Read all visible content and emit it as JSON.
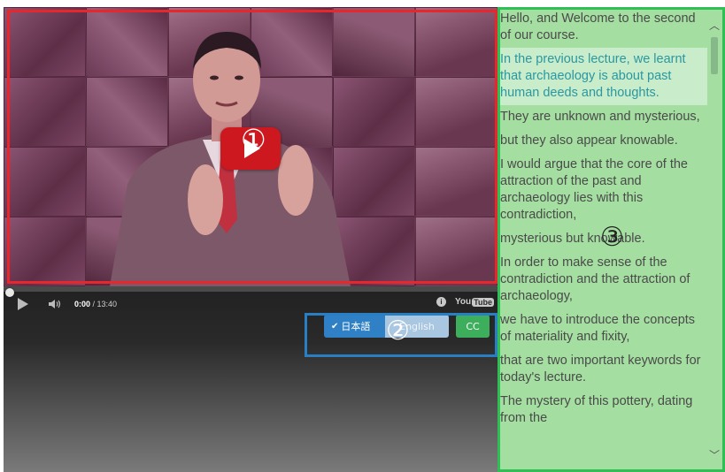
{
  "video": {
    "play_overlay_icon": "play-icon",
    "speaker": "lecturer in suit speaking to camera"
  },
  "controls": {
    "play_icon": "play-icon",
    "volume_icon": "volume-icon",
    "current_time": "0:00",
    "separator": " / ",
    "duration": "13:40",
    "progress": 0,
    "info_icon": "info-icon",
    "logo_you": "You",
    "logo_tube": "Tube"
  },
  "languages": {
    "check": "✔",
    "japanese_label": "日本語",
    "english_label": "English",
    "cc_label": "CC"
  },
  "transcript": {
    "cues": [
      {
        "text": "Hello, and Welcome to the second of our course.",
        "active": false
      },
      {
        "text": "In the previous lecture, we learnt that archaeology is about past human deeds and thoughts.",
        "active": true
      },
      {
        "text": "They are unknown and mysterious,",
        "active": false
      },
      {
        "text": "but they also appear knowable.",
        "active": false
      },
      {
        "text": "I would argue that the core of the attraction of the past and archaeology lies with this contradiction,",
        "active": false
      },
      {
        "text": "mysterious but knowable.",
        "active": false
      },
      {
        "text": "In order to make sense of the contradiction and the attraction of archaeology,",
        "active": false
      },
      {
        "text": "we have to introduce the concepts of materiality and fixity,",
        "active": false
      },
      {
        "text": "that are two important keywords for today's lecture.",
        "active": false
      },
      {
        "text": "The mystery of this pottery, dating from the",
        "active": false
      }
    ]
  },
  "annotations": {
    "one": "①",
    "two": "②",
    "three": "③"
  },
  "colors": {
    "annotation_red": "#e8262b",
    "annotation_blue": "#2a7ec2",
    "annotation_green": "#2fbf55",
    "transcript_bg": "#a4dfa1",
    "active_cue_text": "#2a97a2",
    "japanese_button": "#2f80c4",
    "cc_button": "#3cae5c"
  }
}
